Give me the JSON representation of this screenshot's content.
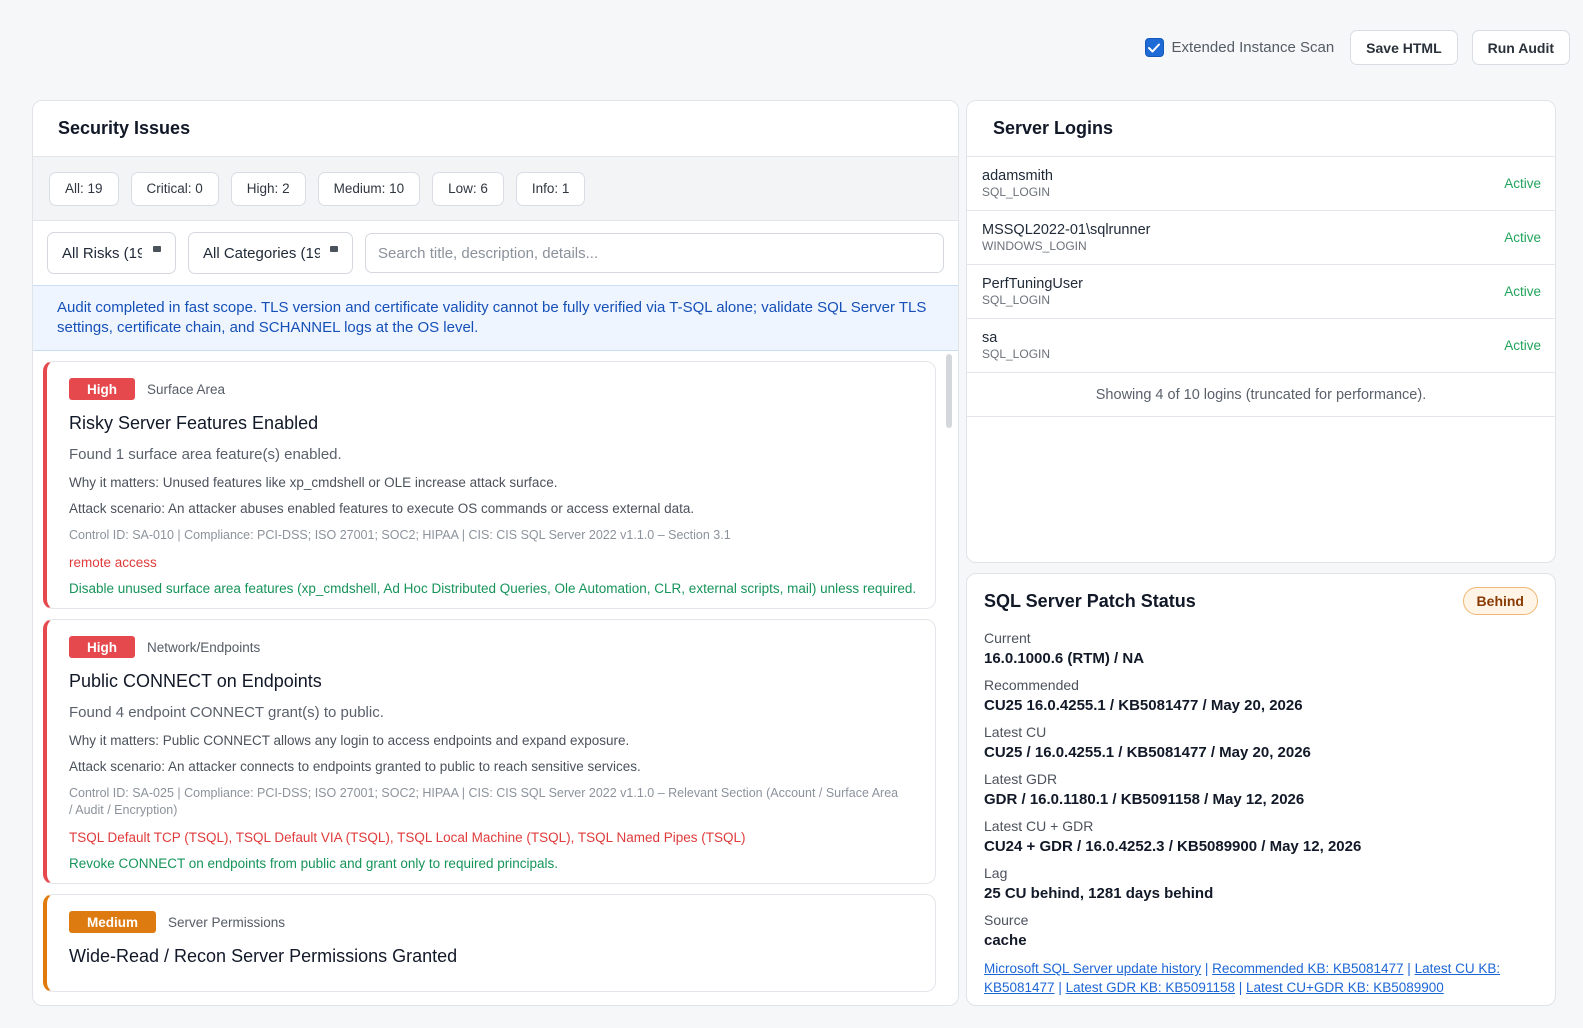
{
  "toolbar": {
    "extended_scan_label": "Extended Instance Scan",
    "extended_scan_checked": true,
    "save_label": "Save HTML",
    "run_label": "Run Audit"
  },
  "issues_panel": {
    "title": "Security Issues",
    "filters": [
      "All: 19",
      "Critical: 0",
      "High: 2",
      "Medium: 10",
      "Low: 6",
      "Info: 1"
    ],
    "risk_select": "All Risks (19)",
    "category_select": "All Categories (19)",
    "search_placeholder": "Search title, description, details...",
    "note": "Audit completed in fast scope. TLS version and certificate validity cannot be fully verified via T-SQL alone; validate SQL Server TLS settings, certificate chain, and SCHANNEL logs at the OS level.",
    "cards": [
      {
        "severity": "High",
        "category": "Surface Area",
        "title": "Risky Server Features Enabled",
        "summary": "Found 1 surface area feature(s) enabled.",
        "why": "Why it matters: Unused features like xp_cmdshell or OLE increase attack surface.",
        "attack": "Attack scenario: An attacker abuses enabled features to execute OS commands or access external data.",
        "control": "Control ID: SA-010 | Compliance: PCI-DSS; ISO 27001; SOC2; HIPAA | CIS: CIS SQL Server 2022 v1.1.0 – Section 3.1",
        "risk": "remote access",
        "fix": "Disable unused surface area features (xp_cmdshell, Ad Hoc Distributed Queries, Ole Automation, CLR, external scripts, mail) unless required."
      },
      {
        "severity": "High",
        "category": "Network/Endpoints",
        "title": "Public CONNECT on Endpoints",
        "summary": "Found 4 endpoint CONNECT grant(s) to public.",
        "why": "Why it matters: Public CONNECT allows any login to access endpoints and expand exposure.",
        "attack": "Attack scenario: An attacker connects to endpoints granted to public to reach sensitive services.",
        "control": "Control ID: SA-025 | Compliance: PCI-DSS; ISO 27001; SOC2; HIPAA | CIS: CIS SQL Server 2022 v1.1.0 – Relevant Section (Account / Surface Area / Audit / Encryption)",
        "risk": "TSQL Default TCP (TSQL), TSQL Default VIA (TSQL), TSQL Local Machine (TSQL), TSQL Named Pipes (TSQL)",
        "fix": "Revoke CONNECT on endpoints from public and grant only to required principals."
      },
      {
        "severity": "Medium",
        "category": "Server Permissions",
        "title": "Wide-Read / Recon Server Permissions Granted"
      }
    ]
  },
  "logins_panel": {
    "title": "Server Logins",
    "logins": [
      {
        "name": "adamsmith",
        "type": "SQL_LOGIN",
        "status": "Active"
      },
      {
        "name": "MSSQL2022-01\\sqlrunner",
        "type": "WINDOWS_LOGIN",
        "status": "Active"
      },
      {
        "name": "PerfTuningUser",
        "type": "SQL_LOGIN",
        "status": "Active"
      },
      {
        "name": "sa",
        "type": "SQL_LOGIN",
        "status": "Active"
      }
    ],
    "footer": "Showing 4 of 10 logins (truncated for performance)."
  },
  "patch_panel": {
    "title": "SQL Server Patch Status",
    "status": "Behind",
    "fields": [
      {
        "label": "Current",
        "value": "16.0.1000.6 (RTM) / NA"
      },
      {
        "label": "Recommended",
        "value": "CU25 16.0.4255.1 / KB5081477 / May 20, 2026"
      },
      {
        "label": "Latest CU",
        "value": "CU25 / 16.0.4255.1 / KB5081477 / May 20, 2026"
      },
      {
        "label": "Latest GDR",
        "value": "GDR / 16.0.1180.1 / KB5091158 / May 12, 2026"
      },
      {
        "label": "Latest CU + GDR",
        "value": "CU24 + GDR / 16.0.4252.3 / KB5089900 / May 12, 2026"
      },
      {
        "label": "Lag",
        "value": "25 CU behind, 1281 days behind"
      },
      {
        "label": "Source",
        "value": "cache"
      }
    ],
    "links": [
      "Microsoft SQL Server update history",
      "Recommended KB: KB5081477",
      "Latest CU KB: KB5081477",
      "Latest GDR KB: KB5091158",
      "Latest CU+GDR KB: KB5089900"
    ]
  },
  "colors": {
    "high": "#e5484d",
    "medium": "#dd7b10",
    "active": "#22a35c",
    "link": "#1d66d6",
    "accent": "#1e6ad6"
  }
}
